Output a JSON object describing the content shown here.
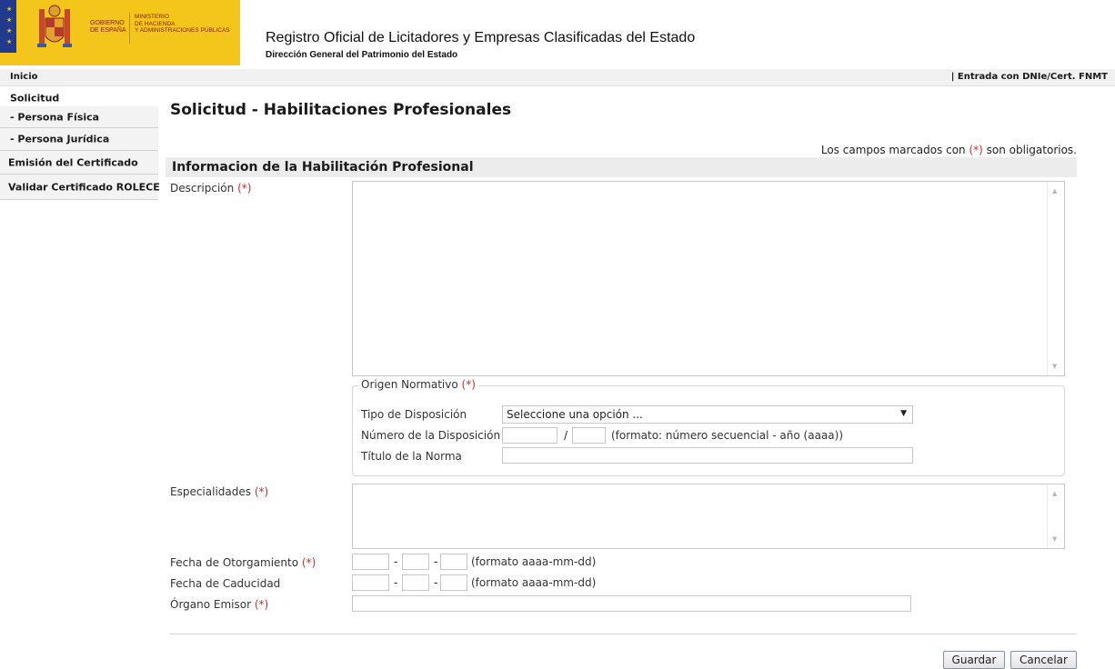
{
  "header": {
    "logo": {
      "gobierno_line1": "GOBIERNO",
      "gobierno_line2": "DE ESPAÑA",
      "ministerio_line1": "MINISTERIO",
      "ministerio_line2": "DE HACIENDA",
      "ministerio_line3": "Y ADMINISTRACIONES PÚBLICAS",
      "brand_color": "#f4c51a"
    },
    "title": "Registro Oficial de Licitadores y Empresas Clasificadas del Estado",
    "subtitle": "Dirección General del Patrimonio del Estado"
  },
  "topbar": {
    "home": "Inicio",
    "login": "| Entrada con DNIe/Cert. FNMT"
  },
  "sidebar": {
    "items": [
      {
        "label": "Solicitud"
      },
      {
        "label": " - Persona Física"
      },
      {
        "label": " - Persona Jurídica"
      },
      {
        "label": "Emisión del Certificado"
      },
      {
        "label": "Validar Certificado ROLECE"
      }
    ]
  },
  "main": {
    "page_title": "Solicitud - Habilitaciones Profesionales",
    "required_note_prefix": "Los campos marcados con ",
    "required_marker": "(*)",
    "required_note_suffix": " son obligatorios.",
    "section_title": "Informacion de la Habilitación Profesional",
    "descripcion_label": "Descripción",
    "origen": {
      "legend": "Origen Normativo",
      "tipo_label": "Tipo de Disposición",
      "tipo_selected": "Seleccione una opción ...",
      "numero_label": "Número de la Disposición",
      "numero_sep": "/",
      "numero_hint": "(formato: número secuencial - año (aaaa))",
      "titulo_label": "Título de la Norma"
    },
    "especialidades_label": "Especialidades",
    "fecha_otorgamiento_label": "Fecha de Otorgamiento",
    "fecha_caducidad_label": "Fecha de Caducidad",
    "date_sep": "-",
    "date_hint": "(formato aaaa-mm-dd)",
    "organo_label": "Órgano Emisor",
    "buttons": {
      "guardar": "Guardar",
      "cancelar": "Cancelar"
    }
  },
  "colors": {
    "required": "#d42a2a",
    "section_bg": "#ececec",
    "sidebar_bg": "#f3f3f3"
  }
}
